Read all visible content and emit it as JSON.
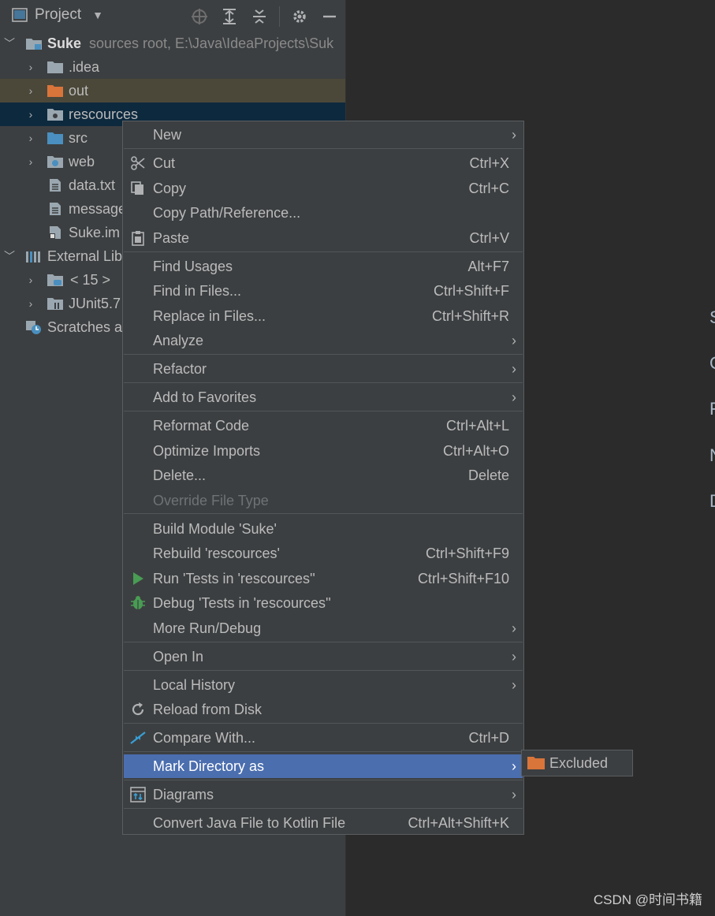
{
  "panel": {
    "title": "Project",
    "icons": [
      "project-icon",
      "dropdown-icon",
      "locate-icon",
      "expand-all-icon",
      "collapse-all-icon",
      "gear-icon",
      "minimize-icon"
    ]
  },
  "tree": [
    {
      "level": 0,
      "arrow": "expanded",
      "icon": "module-folder-icon",
      "label": "Suke",
      "extra": "sources root,  E:\\Java\\IdeaProjects\\Suk"
    },
    {
      "level": 1,
      "arrow": "collapsed",
      "icon": "folder-icon",
      "label": ".idea"
    },
    {
      "level": 1,
      "arrow": "collapsed",
      "icon": "excluded-folder-icon",
      "label": "out"
    },
    {
      "level": 1,
      "arrow": "collapsed",
      "icon": "resources-folder-icon",
      "label": "rescources"
    },
    {
      "level": 1,
      "arrow": "collapsed",
      "icon": "source-folder-icon",
      "label": "src"
    },
    {
      "level": 1,
      "arrow": "collapsed",
      "icon": "web-folder-icon",
      "label": "web"
    },
    {
      "level": 1,
      "arrow": "none",
      "icon": "text-file-icon",
      "label": "data.txt"
    },
    {
      "level": 1,
      "arrow": "none",
      "icon": "text-file-icon",
      "label": "message"
    },
    {
      "level": 1,
      "arrow": "none",
      "icon": "iml-file-icon",
      "label": "Suke.im"
    },
    {
      "level": 0,
      "arrow": "expanded",
      "icon": "library-icon",
      "label": "External Lib"
    },
    {
      "level": 1,
      "arrow": "collapsed",
      "icon": "jdk-folder-icon",
      "label": "< 15 >"
    },
    {
      "level": 1,
      "arrow": "collapsed",
      "icon": "library-jar-icon",
      "label": "JUnit5.7"
    },
    {
      "level": 0,
      "arrow": "none",
      "icon": "scratches-icon",
      "label": "Scratches a"
    }
  ],
  "menu": {
    "new": "New",
    "cut": "Cut",
    "cut_sc": "Ctrl+X",
    "copy": "Copy",
    "copy_sc": "Ctrl+C",
    "copy_path": "Copy Path/Reference...",
    "paste": "Paste",
    "paste_sc": "Ctrl+V",
    "find_usages": "Find Usages",
    "find_usages_sc": "Alt+F7",
    "find_in_files": "Find in Files...",
    "find_in_files_sc": "Ctrl+Shift+F",
    "replace_in_files": "Replace in Files...",
    "replace_in_files_sc": "Ctrl+Shift+R",
    "analyze": "Analyze",
    "refactor": "Refactor",
    "add_favorites": "Add to Favorites",
    "reformat": "Reformat Code",
    "reformat_sc": "Ctrl+Alt+L",
    "optimize": "Optimize Imports",
    "optimize_sc": "Ctrl+Alt+O",
    "delete": "Delete...",
    "delete_sc": "Delete",
    "override": "Override File Type",
    "build_module": "Build Module 'Suke'",
    "rebuild": "Rebuild 'rescources'",
    "rebuild_sc": "Ctrl+Shift+F9",
    "run": "Run 'Tests in 'rescources''",
    "run_sc": "Ctrl+Shift+F10",
    "debug": "Debug 'Tests in 'rescources''",
    "more_run": "More Run/Debug",
    "open_in": "Open In",
    "local_history": "Local History",
    "reload": "Reload from Disk",
    "compare": "Compare With...",
    "compare_sc": "Ctrl+D",
    "mark_dir": "Mark Directory as",
    "diagrams": "Diagrams",
    "convert": "Convert Java File to Kotlin File",
    "convert_sc": "Ctrl+Alt+Shift+K",
    "submenu_arrow": "›"
  },
  "submenu": {
    "excluded": "Excluded"
  },
  "editor_edge_chars": [
    "S",
    "G",
    "F",
    "N",
    "D"
  ],
  "watermark": "CSDN @时间书籍",
  "colors": {
    "panel_bg": "#3c3f41",
    "editor_bg": "#2b2b2b",
    "selection": "#0d293e",
    "excluded_row": "#4b4839",
    "menu_highlight": "#4b6eaf",
    "excluded_folder": "#d9743a",
    "source_folder": "#4a8fbf"
  }
}
